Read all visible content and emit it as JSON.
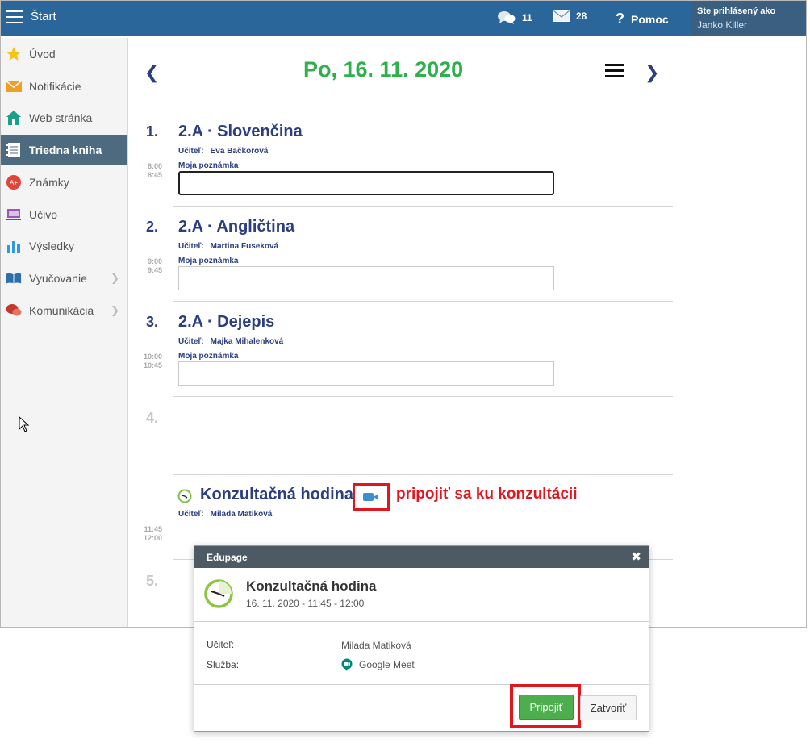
{
  "topbar": {
    "start_label": "Štart",
    "messages_count": "11",
    "mail_count": "28",
    "help_label": "Pomoc",
    "user_line1": "Ste prihlásený ako",
    "user_name": "Janko Killer",
    "bg_color": "#2a6699"
  },
  "sidebar": {
    "items": [
      {
        "label": "Úvod",
        "icon": "star-icon"
      },
      {
        "label": "Notifikácie",
        "icon": "envelope-icon"
      },
      {
        "label": "Web stránka",
        "icon": "home-icon"
      },
      {
        "label": "Triedna kniha",
        "icon": "notebook-icon",
        "active": true
      },
      {
        "label": "Známky",
        "icon": "grades-icon"
      },
      {
        "label": "Učivo",
        "icon": "curriculum-icon"
      },
      {
        "label": "Výsledky",
        "icon": "bar-chart-icon"
      },
      {
        "label": "Vyučovanie",
        "icon": "book-icon",
        "has_submenu": true
      },
      {
        "label": "Komunikácia",
        "icon": "chat-icon",
        "has_submenu": true
      }
    ]
  },
  "main": {
    "date_title": "Po, 16. 11. 2020",
    "lessons": [
      {
        "number": "1.",
        "title": "2.A · Slovenčina",
        "teacher_label": "Učiteľ:",
        "teacher": "Eva Bačkorová",
        "note_label": "Moja poznámka",
        "time_start": "8:00",
        "time_end": "8:45"
      },
      {
        "number": "2.",
        "title": "2.A · Angličtina",
        "teacher_label": "Učiteľ:",
        "teacher": "Martina Fuseková",
        "note_label": "Moja poznámka",
        "time_start": "9:00",
        "time_end": "9:45"
      },
      {
        "number": "3.",
        "title": "2.A · Dejepis",
        "teacher_label": "Učiteľ:",
        "teacher": "Majka Mihalenková",
        "note_label": "Moja poznámka",
        "time_start": "10:00",
        "time_end": "10:45"
      }
    ],
    "empty_lesson_4": "4.",
    "consultation": {
      "title": "Konzultačná hodina",
      "teacher_label": "Učiteľ:",
      "teacher": "Milada Matiková",
      "time_start": "11:45",
      "time_end": "12:00",
      "annotation": "pripojiť sa ku konzultácii"
    },
    "empty_lesson_5": "5.",
    "accent_green": "#2fb04c",
    "accent_blue": "#2b3e80",
    "annotation_red": "#e2161e"
  },
  "dialog": {
    "header": "Edupage",
    "title": "Konzultačná hodina",
    "datetime": "16. 11. 2020 - 11:45 - 12:00",
    "teacher_label": "Učiteľ:",
    "teacher_value": "Milada Matiková",
    "service_label": "Služba:",
    "service_value": "Google Meet",
    "join_label": "Pripojiť",
    "close_label": "Zatvoriť"
  }
}
